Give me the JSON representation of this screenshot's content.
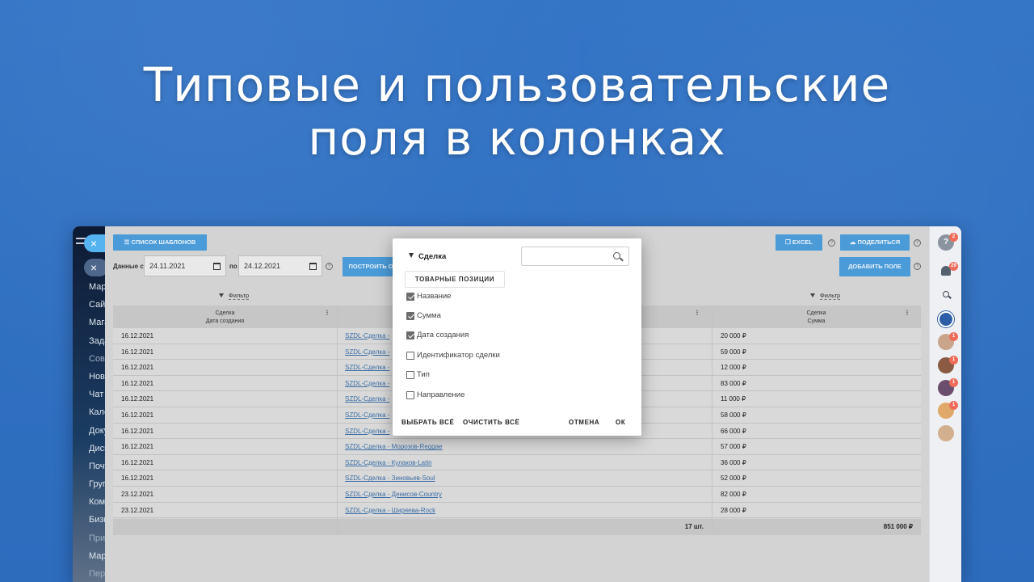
{
  "headline": {
    "line1": "Типовые и пользовательские",
    "line2": "поля в колонках"
  },
  "nav": {
    "close_pill": "×",
    "items": [
      "Мар",
      "Сайт",
      "Мага",
      "Зада",
      "Сов",
      "Нов",
      "Чат",
      "Кале",
      "Доку",
      "Диск",
      "Почт",
      "Груп",
      "Ком",
      "Бизн",
      "При",
      "Мар",
      "Пер"
    ]
  },
  "toolbar": {
    "templates_button": "СПИСОК ШАБЛОНОВ",
    "excel_button": "EXCEL",
    "share_button": "ПОДЕЛИТЬСЯ",
    "add_field_button": "ДОБАВИТЬ ПОЛЕ",
    "build_button": "ПОСТРОИТЬ О",
    "date_from_label": "Данные с",
    "date_from": "24.11.2021",
    "date_to_label": "по",
    "date_to": "24.12.2021",
    "filter_label": "Фильтр"
  },
  "table": {
    "col1_header_line1": "Сделка",
    "col1_header_line2": "Дата создания",
    "col3_header_line1": "Сделка",
    "col3_header_line2": "Сумма",
    "rows": [
      {
        "date": "16.12.2021",
        "deal": "SZDL-Сделка - ",
        "sum": "20 000 ₽"
      },
      {
        "date": "16.12.2021",
        "deal": "SZDL-Сделка - ",
        "sum": "59 000 ₽"
      },
      {
        "date": "16.12.2021",
        "deal": "SZDL-Сделка - ",
        "sum": "12 000 ₽"
      },
      {
        "date": "16.12.2021",
        "deal": "SZDL-Сделка - ",
        "sum": "83 000 ₽"
      },
      {
        "date": "16.12.2021",
        "deal": "SZDL-Сделка - ",
        "sum": "11 000 ₽"
      },
      {
        "date": "16.12.2021",
        "deal": "SZDL-Сделка - ",
        "sum": "58 000 ₽"
      },
      {
        "date": "16.12.2021",
        "deal": "SZDL-Сделка - ",
        "sum": "66 000 ₽"
      },
      {
        "date": "16.12.2021",
        "deal": "SZDL-Сделка - Морозов-Reggae",
        "sum": "57 000 ₽"
      },
      {
        "date": "16.12.2021",
        "deal": "SZDL-Сделка - Кулаков-Latin",
        "sum": "36 000 ₽"
      },
      {
        "date": "16.12.2021",
        "deal": "SZDL-Сделка - Зиновьев-Soul",
        "sum": "52 000 ₽"
      },
      {
        "date": "23.12.2021",
        "deal": "SZDL-Сделка - Денисов-Country",
        "sum": "82 000 ₽"
      },
      {
        "date": "23.12.2021",
        "deal": "SZDL-Сделка - Ширяева-Rock",
        "sum": "28 000 ₽"
      }
    ],
    "footer_count": "17 шт.",
    "footer_total": "851 000 ₽"
  },
  "rail": {
    "help_badge": "2",
    "bell_badge": "29",
    "avatar_badges": [
      "1",
      "1",
      "1",
      "1"
    ]
  },
  "modal": {
    "title": "Сделка",
    "search_placeholder": "",
    "tab_chip": "ТОВАРНЫЕ ПОЗИЦИИ",
    "options": [
      {
        "label": "Название",
        "checked": true
      },
      {
        "label": "Сумма",
        "checked": true
      },
      {
        "label": "Дата создания",
        "checked": true
      },
      {
        "label": "Идентификатор сделки",
        "checked": false
      },
      {
        "label": "Тип",
        "checked": false
      },
      {
        "label": "Направление",
        "checked": false
      }
    ],
    "select_all": "ВЫБРАТЬ ВСЁ",
    "clear_all": "ОЧИСТИТЬ ВСЁ",
    "cancel": "ОТМЕНА",
    "ok": "ОК"
  },
  "colors": {
    "background": "#2f6fc0",
    "accent_button": "#4a9bd8",
    "badge": "#ef6b5a"
  }
}
